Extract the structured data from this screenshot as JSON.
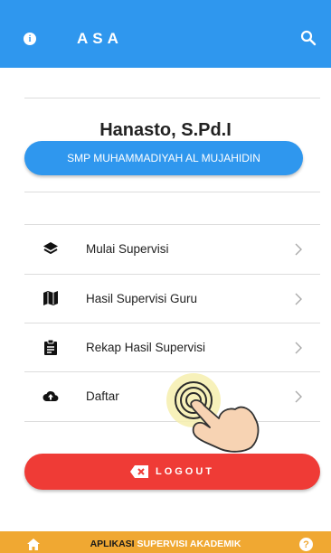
{
  "appbar": {
    "title": "ASA",
    "info_icon": "info-icon",
    "search_icon": "search-icon",
    "color": "#2f97ee"
  },
  "profile": {
    "name": "Hanasto, S.Pd.I",
    "school": "SMP MUHAMMADIYAH AL MUJAHIDIN"
  },
  "menu": [
    {
      "label": "Mulai Supervisi",
      "icon": "layers-icon"
    },
    {
      "label": "Hasil Supervisi Guru",
      "icon": "map-icon"
    },
    {
      "label": "Rekap Hasil Supervisi",
      "icon": "clipboard-icon"
    },
    {
      "label": "Daftar",
      "icon": "cloud-upload-icon"
    }
  ],
  "logout": {
    "label": "LOGOUT",
    "icon": "close-icon",
    "color": "#ef3b36"
  },
  "bottombar": {
    "brand_part1": "APLIKASI",
    "brand_part2": "SUPERVISI AKADEMIK",
    "home_icon": "home-icon",
    "help_icon": "help-icon",
    "color": "#f0a832"
  }
}
